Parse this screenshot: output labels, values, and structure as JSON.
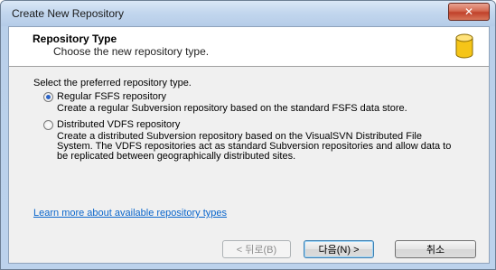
{
  "window": {
    "title": "Create New Repository",
    "close_glyph": "✕"
  },
  "header": {
    "title": "Repository Type",
    "subtitle": "Choose the new repository type.",
    "icon": "database-icon"
  },
  "prompt": "Select the preferred repository type.",
  "options": [
    {
      "label": "Regular FSFS repository",
      "description": "Create a regular Subversion repository based on the standard FSFS data store.",
      "selected": true
    },
    {
      "label": "Distributed VDFS repository",
      "description": "Create a distributed Subversion repository based on the VisualSVN Distributed File System. The VDFS repositories act as standard Subversion repositories and allow data to be replicated between geographically distributed sites.",
      "selected": false
    }
  ],
  "link": "Learn more about available repository types",
  "buttons": {
    "back": "< 뒤로(B)",
    "next": "다음(N) >",
    "cancel": "취소"
  },
  "colors": {
    "link": "#0a66cc",
    "accent": "#2b63c6",
    "icon_fill": "#f5c518"
  }
}
